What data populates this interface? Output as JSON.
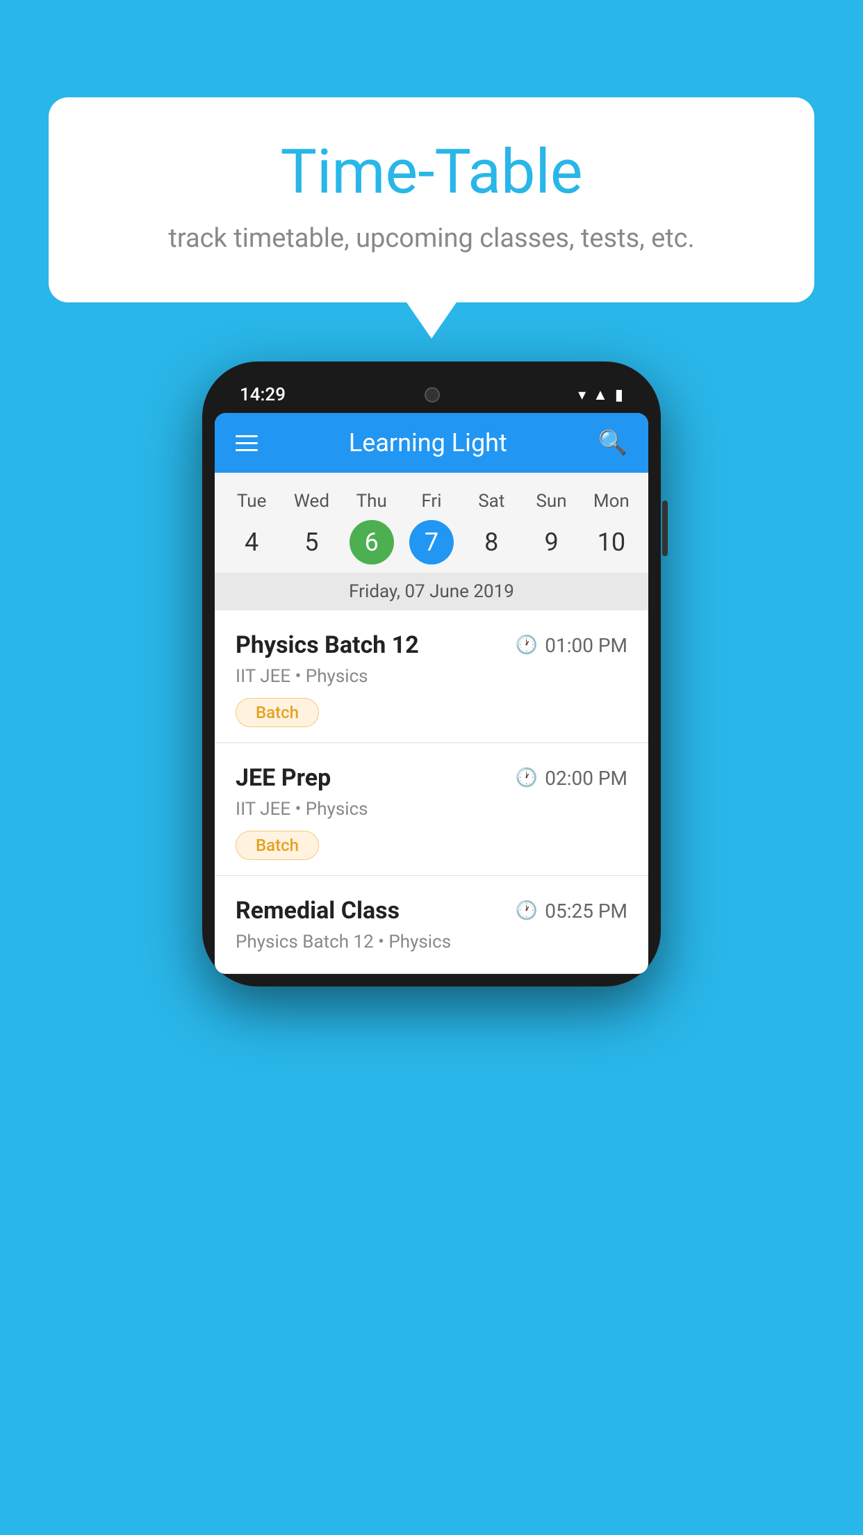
{
  "background_color": "#29b6e8",
  "speech_bubble": {
    "title": "Time-Table",
    "subtitle": "track timetable, upcoming classes, tests, etc."
  },
  "phone": {
    "status_bar": {
      "time": "14:29"
    },
    "app_bar": {
      "title": "Learning Light"
    },
    "calendar": {
      "day_names": [
        "Tue",
        "Wed",
        "Thu",
        "Fri",
        "Sat",
        "Sun",
        "Mon"
      ],
      "day_numbers": [
        {
          "num": "4",
          "state": "normal"
        },
        {
          "num": "5",
          "state": "normal"
        },
        {
          "num": "6",
          "state": "today"
        },
        {
          "num": "7",
          "state": "selected"
        },
        {
          "num": "8",
          "state": "normal"
        },
        {
          "num": "9",
          "state": "normal"
        },
        {
          "num": "10",
          "state": "normal"
        }
      ],
      "selected_date_label": "Friday, 07 June 2019"
    },
    "schedule": {
      "items": [
        {
          "title": "Physics Batch 12",
          "time": "01:00 PM",
          "subtitle": "IIT JEE • Physics",
          "tag": "Batch"
        },
        {
          "title": "JEE Prep",
          "time": "02:00 PM",
          "subtitle": "IIT JEE • Physics",
          "tag": "Batch"
        },
        {
          "title": "Remedial Class",
          "time": "05:25 PM",
          "subtitle": "Physics Batch 12 • Physics",
          "tag": null
        }
      ]
    }
  }
}
